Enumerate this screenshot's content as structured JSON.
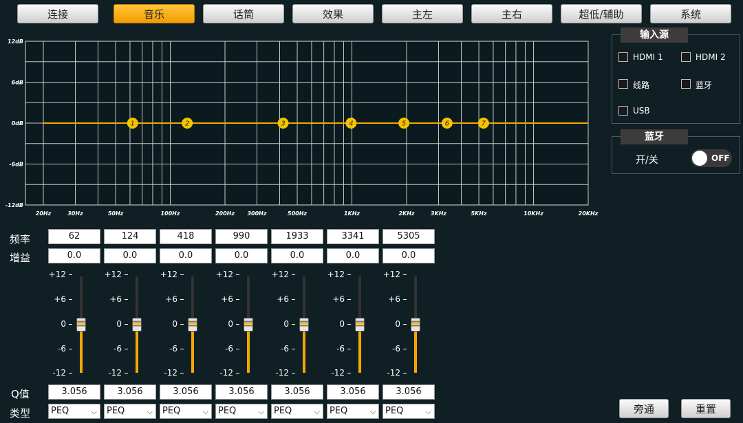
{
  "tabs": [
    {
      "label": "连接",
      "active": false
    },
    {
      "label": "音乐",
      "active": true
    },
    {
      "label": "话筒",
      "active": false
    },
    {
      "label": "效果",
      "active": false
    },
    {
      "label": "主左",
      "active": false
    },
    {
      "label": "主右",
      "active": false
    },
    {
      "label": "超低/辅助",
      "active": false
    },
    {
      "label": "系统",
      "active": false
    }
  ],
  "eq_graph": {
    "y_labels": [
      "12dB",
      "6dB",
      "0dB",
      "-6dB",
      "-12dB"
    ],
    "x_labels": [
      "20Hz",
      "30Hz",
      "50Hz",
      "100Hz",
      "200Hz",
      "300Hz",
      "500Hz",
      "1KHz",
      "2KHz",
      "3KHz",
      "5KHz",
      "10KHz",
      "20KHz"
    ],
    "x_label_freqs": [
      20,
      30,
      50,
      100,
      200,
      300,
      500,
      1000,
      2000,
      3000,
      5000,
      10000,
      20000
    ],
    "band_nums": [
      "1",
      "2",
      "3",
      "4",
      "5",
      "6",
      "7"
    ],
    "curve_color": "#f5a800"
  },
  "labels": {
    "freq": "频率",
    "gain": "增益",
    "q": "Q值",
    "type": "类型"
  },
  "bands": [
    {
      "freq": "62",
      "gain": "0.0",
      "q": "3.056",
      "type": "PEQ",
      "level": 0
    },
    {
      "freq": "124",
      "gain": "0.0",
      "q": "3.056",
      "type": "PEQ",
      "level": 0
    },
    {
      "freq": "418",
      "gain": "0.0",
      "q": "3.056",
      "type": "PEQ",
      "level": 0
    },
    {
      "freq": "990",
      "gain": "0.0",
      "q": "3.056",
      "type": "PEQ",
      "level": 0
    },
    {
      "freq": "1933",
      "gain": "0.0",
      "q": "3.056",
      "type": "PEQ",
      "level": 0
    },
    {
      "freq": "3341",
      "gain": "0.0",
      "q": "3.056",
      "type": "PEQ",
      "level": 0
    },
    {
      "freq": "5305",
      "gain": "0.0",
      "q": "3.056",
      "type": "PEQ",
      "level": 0
    }
  ],
  "slider_ticks": [
    "+12",
    "+6",
    "0",
    "-6",
    "-12"
  ],
  "input_source": {
    "title": "输入源",
    "options": [
      {
        "label": "HDMI 1",
        "checked": false
      },
      {
        "label": "HDMI 2",
        "checked": false
      },
      {
        "label": "线路",
        "checked": false
      },
      {
        "label": "蓝牙",
        "checked": false
      },
      {
        "label": "USB",
        "checked": false
      }
    ]
  },
  "bluetooth": {
    "title": "蓝牙",
    "switch_label": "开/关",
    "state": "OFF"
  },
  "buttons": {
    "bypass": "旁通",
    "reset": "重置"
  }
}
